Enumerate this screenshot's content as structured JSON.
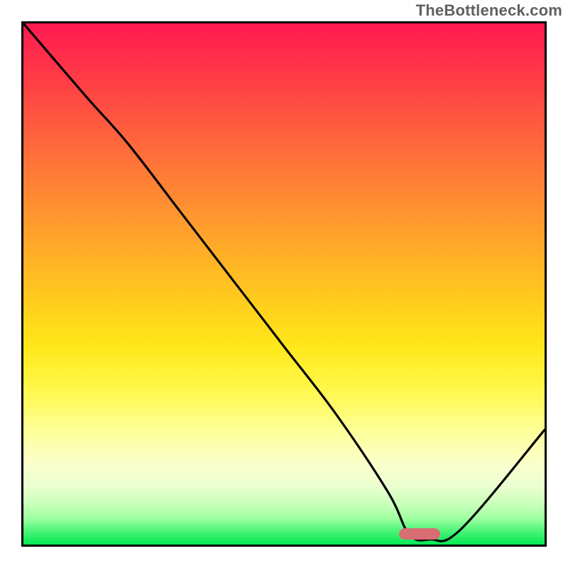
{
  "watermark": "TheBottleneck.com",
  "chart_data": {
    "type": "line",
    "title": "",
    "xlabel": "",
    "ylabel": "",
    "xlim": [
      0,
      100
    ],
    "ylim": [
      0,
      100
    ],
    "grid": false,
    "legend": false,
    "series": [
      {
        "name": "bottleneck-curve",
        "x": [
          0,
          12,
          20,
          30,
          40,
          50,
          60,
          70,
          74,
          78,
          84,
          100
        ],
        "values": [
          100,
          86,
          77,
          64,
          51,
          38,
          25,
          10,
          2,
          1,
          3,
          22
        ]
      }
    ],
    "annotations": [
      {
        "name": "optimal-marker",
        "type": "pill",
        "x": 76,
        "y": 2,
        "color": "#d86e74"
      }
    ],
    "background_gradient": {
      "type": "vertical",
      "stops": [
        {
          "pos": 0.0,
          "color": "#ff1a50"
        },
        {
          "pos": 0.24,
          "color": "#ff6a3c"
        },
        {
          "pos": 0.52,
          "color": "#ffc81f"
        },
        {
          "pos": 0.78,
          "color": "#fdff92"
        },
        {
          "pos": 0.92,
          "color": "#c6ffb0"
        },
        {
          "pos": 1.0,
          "color": "#2dff6a"
        }
      ]
    }
  }
}
